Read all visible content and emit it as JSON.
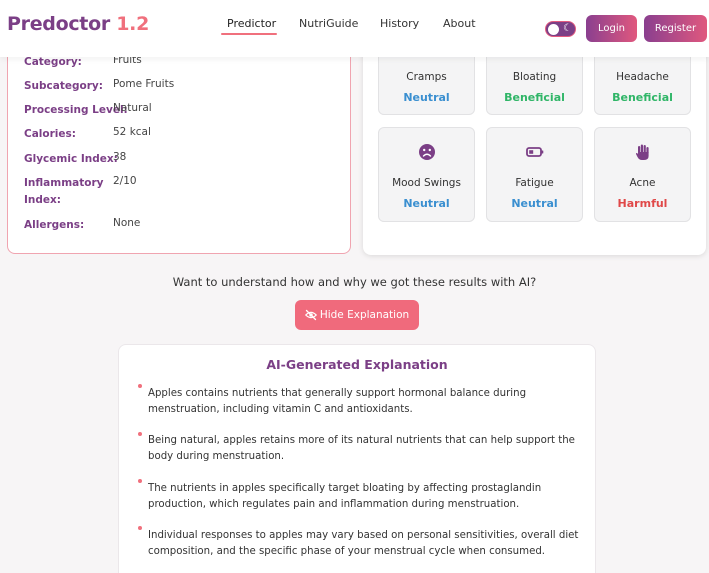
{
  "brand": {
    "name": "Predoctor",
    "version": "1.2"
  },
  "nav": {
    "links": [
      "Predictor",
      "NutriGuide",
      "History",
      "About"
    ],
    "login": "Login",
    "register": "Register"
  },
  "details": {
    "rows": [
      {
        "label": "Category:",
        "value": "Fruits"
      },
      {
        "label": "Subcategory:",
        "value": "Pome Fruits"
      },
      {
        "label": "Processing Level:",
        "value": "Natural"
      },
      {
        "label": "Calories:",
        "value": "52 kcal"
      },
      {
        "label": "Glycemic Index:",
        "value": "38"
      },
      {
        "label": "Inflammatory Index:",
        "value": "2/10"
      },
      {
        "label": "Allergens:",
        "value": "None"
      }
    ]
  },
  "symptoms": [
    {
      "name": "Cramps",
      "effect": "Neutral",
      "color": "#3a8fd0"
    },
    {
      "name": "Bloating",
      "effect": "Beneficial",
      "color": "#2fb567"
    },
    {
      "name": "Headache",
      "effect": "Beneficial",
      "color": "#2fb567"
    },
    {
      "name": "Mood Swings",
      "effect": "Neutral",
      "color": "#3a8fd0",
      "icon": "sad-face-icon"
    },
    {
      "name": "Fatigue",
      "effect": "Neutral",
      "color": "#3a8fd0",
      "icon": "low-battery-icon"
    },
    {
      "name": "Acne",
      "effect": "Harmful",
      "color": "#e04848",
      "icon": "hand-icon"
    }
  ],
  "explanation": {
    "question": "Want to understand how and why we got these results with AI?",
    "hide_button": "Hide Explanation",
    "title": "AI-Generated Explanation",
    "items": [
      "Apples contains nutrients that generally support hormonal balance during menstruation, including vitamin C and antioxidants.",
      "Being natural, apples retains more of its natural nutrients that can help support the body during menstruation.",
      "The nutrients in apples specifically target bloating by affecting prostaglandin production, which regulates pain and inflammation during menstruation.",
      "Individual responses to apples may vary based on personal sensitivities, overall diet composition, and the specific phase of your menstrual cycle when consumed."
    ]
  },
  "colors": {
    "brand_purple": "#7b3f86",
    "accent_pink": "#f0707d",
    "neutral": "#3a8fd0",
    "beneficial": "#2fb567",
    "harmful": "#e04848"
  }
}
